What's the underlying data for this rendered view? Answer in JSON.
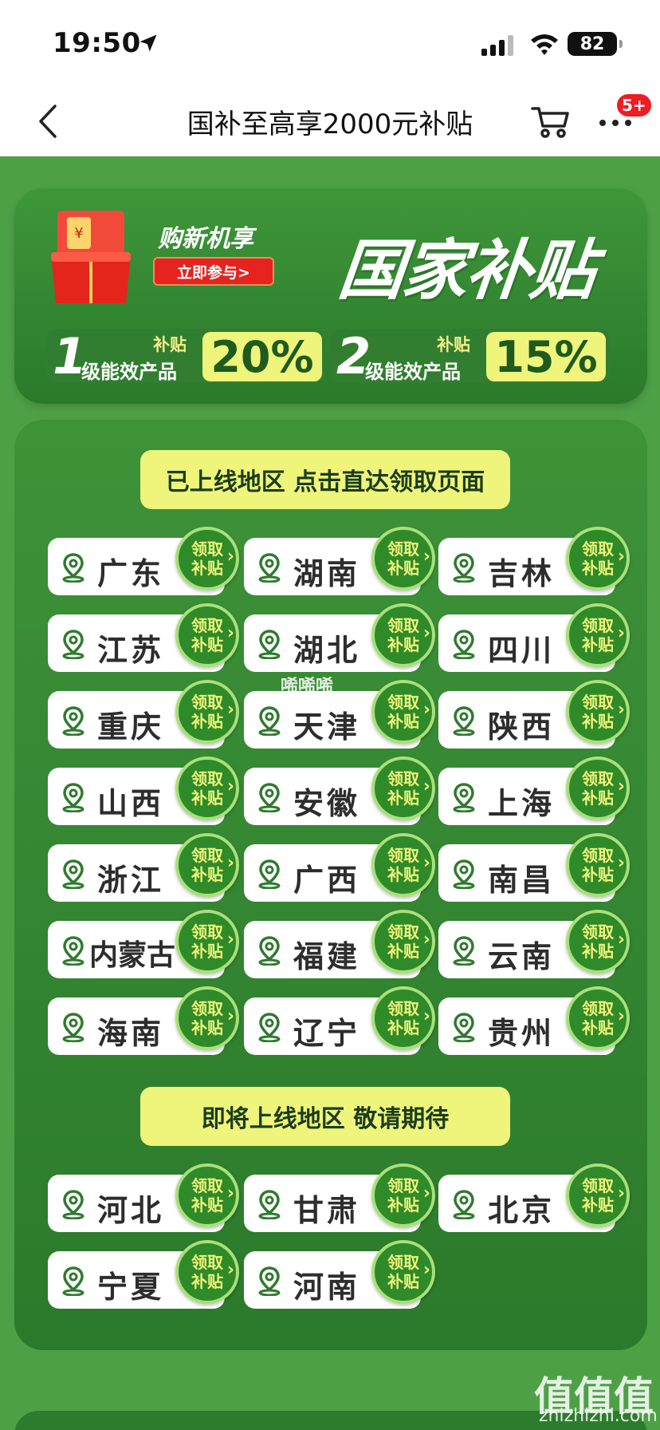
{
  "status": {
    "time": "19:50",
    "battery": "82"
  },
  "header": {
    "title": "国补至高享2000元补贴",
    "badge": "5+"
  },
  "banner": {
    "sub_title": "购新机享",
    "join_label": "立即参与>",
    "title": "国家补贴",
    "rates": [
      {
        "level": "1",
        "small": "补贴",
        "label": "级能效产品",
        "percent": "20%"
      },
      {
        "level": "2",
        "small": "补贴",
        "label": "级能效产品",
        "percent": "15%"
      }
    ]
  },
  "online": {
    "title": "已上线地区 点击直达领取页面",
    "regions": [
      "广东",
      "湖南",
      "吉林",
      "江苏",
      "湖北",
      "四川",
      "重庆",
      "天津",
      "陕西",
      "山西",
      "安徽",
      "上海",
      "浙江",
      "广西",
      "南昌",
      "内蒙古",
      "福建",
      "云南",
      "海南",
      "辽宁",
      "贵州"
    ]
  },
  "upcoming": {
    "title": "即将上线地区 敬请期待",
    "regions": [
      "河北",
      "甘肃",
      "北京",
      "宁夏",
      "河南"
    ]
  },
  "claim_label_top": "领取",
  "claim_label_bottom": "补贴",
  "watermark": "唏唏唏",
  "brand": {
    "name": "值值值",
    "url": "zhizhizhi.com"
  }
}
